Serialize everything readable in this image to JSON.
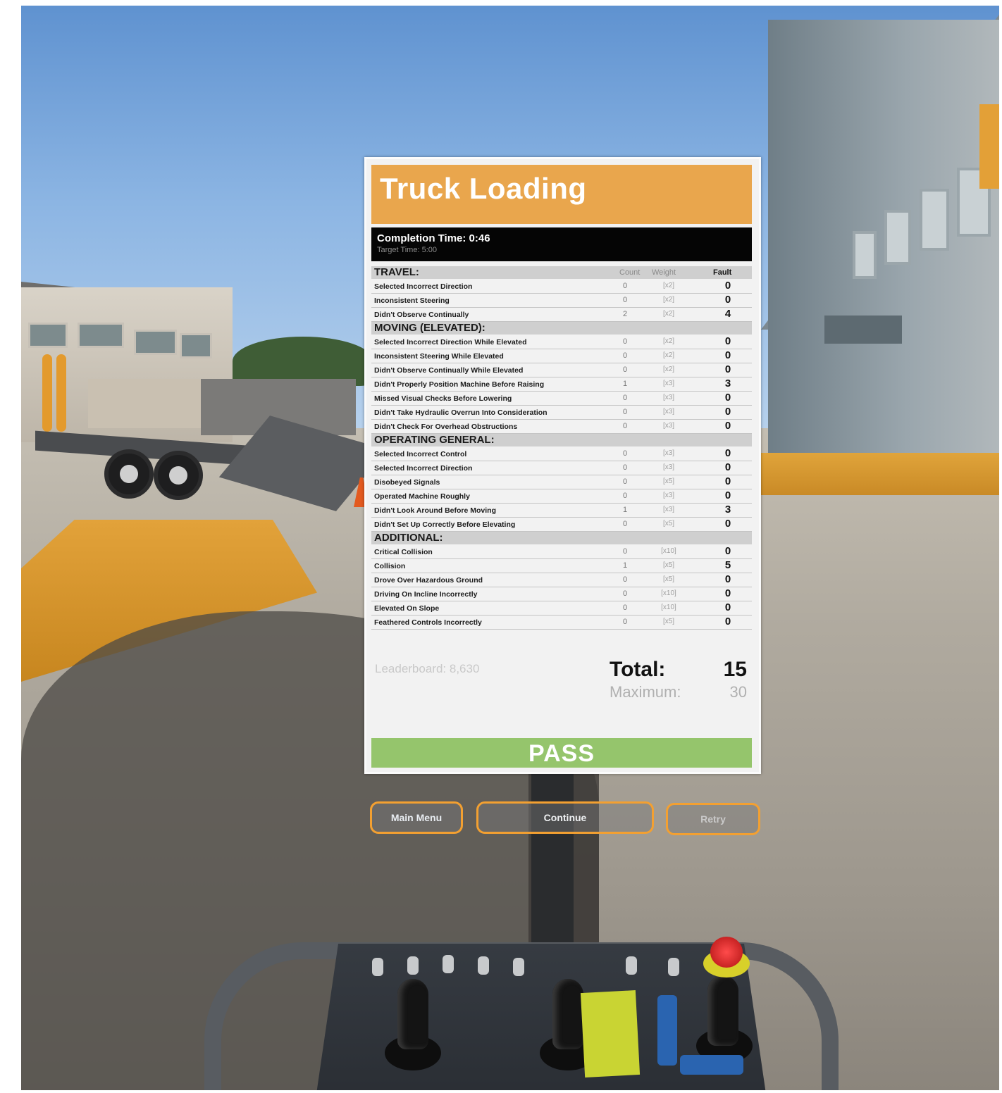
{
  "card": {
    "title": "Truck Loading",
    "completion_time": "Completion Time: 0:46",
    "target_time": "Target Time: 5:00",
    "columns": {
      "count": "Count",
      "weight": "Weight",
      "fault": "Fault"
    },
    "sections": [
      {
        "title": "TRAVEL:",
        "rows": [
          {
            "label": "Selected Incorrect Direction",
            "count": "0",
            "weight": "[x2]",
            "fault": "0"
          },
          {
            "label": "Inconsistent Steering",
            "count": "0",
            "weight": "[x2]",
            "fault": "0"
          },
          {
            "label": "Didn't Observe Continually",
            "count": "2",
            "weight": "[x2]",
            "fault": "4"
          }
        ]
      },
      {
        "title": "MOVING (ELEVATED):",
        "rows": [
          {
            "label": "Selected Incorrect Direction While Elevated",
            "count": "0",
            "weight": "[x2]",
            "fault": "0"
          },
          {
            "label": "Inconsistent Steering While Elevated",
            "count": "0",
            "weight": "[x2]",
            "fault": "0"
          },
          {
            "label": "Didn't Observe Continually While Elevated",
            "count": "0",
            "weight": "[x2]",
            "fault": "0"
          },
          {
            "label": "Didn't Properly Position Machine Before Raising",
            "count": "1",
            "weight": "[x3]",
            "fault": "3"
          },
          {
            "label": "Missed Visual Checks Before Lowering",
            "count": "0",
            "weight": "[x3]",
            "fault": "0"
          },
          {
            "label": "Didn't Take Hydraulic Overrun Into Consideration",
            "count": "0",
            "weight": "[x3]",
            "fault": "0"
          },
          {
            "label": "Didn't Check For Overhead Obstructions",
            "count": "0",
            "weight": "[x3]",
            "fault": "0"
          }
        ]
      },
      {
        "title": "OPERATING GENERAL:",
        "rows": [
          {
            "label": "Selected Incorrect Control",
            "count": "0",
            "weight": "[x3]",
            "fault": "0"
          },
          {
            "label": "Selected Incorrect Direction",
            "count": "0",
            "weight": "[x3]",
            "fault": "0"
          },
          {
            "label": "Disobeyed Signals",
            "count": "0",
            "weight": "[x5]",
            "fault": "0"
          },
          {
            "label": "Operated Machine Roughly",
            "count": "0",
            "weight": "[x3]",
            "fault": "0"
          },
          {
            "label": "Didn't Look Around Before Moving",
            "count": "1",
            "weight": "[x3]",
            "fault": "3"
          },
          {
            "label": "Didn't Set Up Correctly Before Elevating",
            "count": "0",
            "weight": "[x5]",
            "fault": "0"
          }
        ]
      },
      {
        "title": "ADDITIONAL:",
        "rows": [
          {
            "label": "Critical Collision",
            "count": "0",
            "weight": "[x10]",
            "fault": "0"
          },
          {
            "label": "Collision",
            "count": "1",
            "weight": "[x5]",
            "fault": "5"
          },
          {
            "label": "Drove Over Hazardous Ground",
            "count": "0",
            "weight": "[x5]",
            "fault": "0"
          },
          {
            "label": "Driving On Incline Incorrectly",
            "count": "0",
            "weight": "[x10]",
            "fault": "0"
          },
          {
            "label": "Elevated On Slope",
            "count": "0",
            "weight": "[x10]",
            "fault": "0"
          },
          {
            "label": "Feathered Controls Incorrectly",
            "count": "0",
            "weight": "[x5]",
            "fault": "0"
          }
        ]
      }
    ],
    "leaderboard": "Leaderboard: 8,630",
    "total_label": "Total:",
    "total_value": "15",
    "maximum_label": "Maximum:",
    "maximum_value": "30",
    "result": "PASS"
  },
  "buttons": {
    "main_menu": "Main Menu",
    "continue": "Continue",
    "retry": "Retry"
  },
  "colors": {
    "header_orange": "#e9a64d",
    "pass_green": "#95c56c",
    "button_border": "#f3a031"
  }
}
